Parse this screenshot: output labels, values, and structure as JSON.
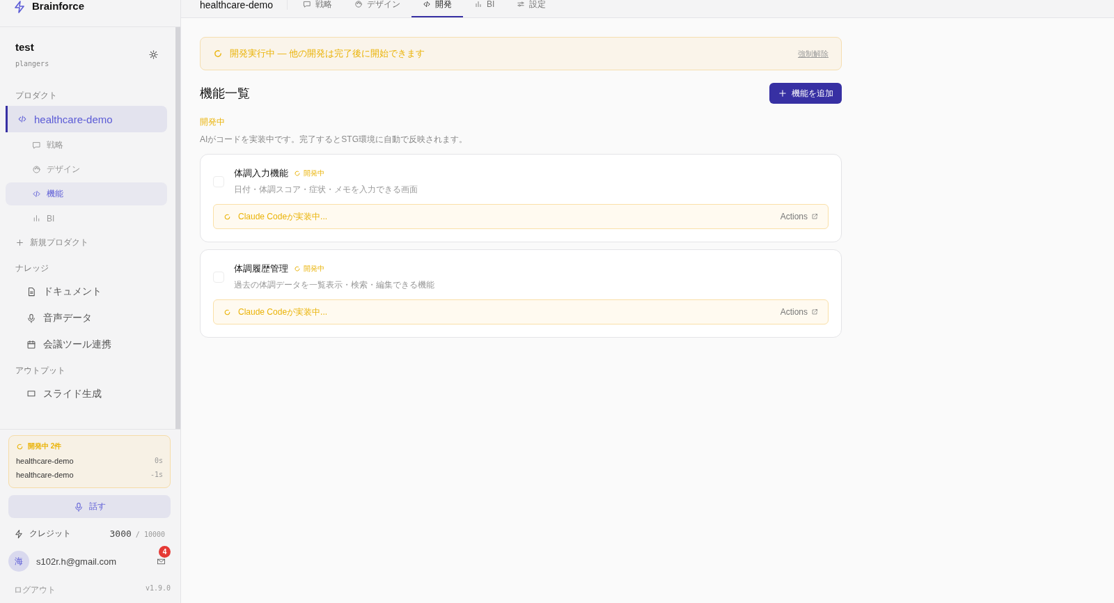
{
  "brand": {
    "name": "Brainforce"
  },
  "workspace": {
    "name": "test",
    "org": "plangers"
  },
  "product_section": {
    "label": "プロダクト",
    "products": [
      {
        "name": "healthcare-demo",
        "selected": true,
        "children": [
          {
            "label": "戦略",
            "kind": "chat",
            "selected": false
          },
          {
            "label": "デザイン",
            "kind": "palette",
            "selected": false
          },
          {
            "label": "機能",
            "kind": "code",
            "selected": true
          },
          {
            "label": "BI",
            "kind": "chart",
            "selected": false
          }
        ]
      }
    ],
    "new_product": "新規プロダクト"
  },
  "knowledge_section": {
    "label": "ナレッジ",
    "items": [
      {
        "label": "ドキュメント",
        "kind": "doc"
      },
      {
        "label": "音声データ",
        "kind": "mic"
      },
      {
        "label": "会議ツール連携",
        "kind": "calendar"
      }
    ]
  },
  "output_section": {
    "label": "アウトプット",
    "items": [
      {
        "label": "スライド生成",
        "kind": "slide"
      }
    ]
  },
  "running_panel": {
    "title": "開発中 2件",
    "items": [
      {
        "name": "healthcare-demo",
        "time": "0s"
      },
      {
        "name": "healthcare-demo",
        "time": "-1s"
      }
    ]
  },
  "talk_button": "話す",
  "credits": {
    "label": "クレジット",
    "value": "3000",
    "separator": "/",
    "total": "10000"
  },
  "user": {
    "avatar": "海",
    "email": "s102r.h@gmail.com",
    "unread": "4"
  },
  "footer": {
    "logout": "ログアウト",
    "version": "v1.9.0"
  },
  "header": {
    "project": "healthcare-demo",
    "tabs": [
      {
        "label": "戦略",
        "kind": "chat",
        "selected": false
      },
      {
        "label": "デザイン",
        "kind": "palette",
        "selected": false
      },
      {
        "label": "開発",
        "kind": "code",
        "selected": true
      },
      {
        "label": "BI",
        "kind": "chart",
        "selected": false
      },
      {
        "label": "設定",
        "kind": "sliders",
        "selected": false
      }
    ]
  },
  "banner": {
    "text": "開発実行中 — 他の開発は完了後に開始できます",
    "action": "強制解除"
  },
  "page_title": "機能一覧",
  "add_button": "機能を追加",
  "group": {
    "status": "開発中",
    "description": "AIがコードを実装中です。完了するとSTG環境に自動で反映されます。"
  },
  "features": [
    {
      "title": "体調入力機能",
      "status": "開発中",
      "description": "日付・体調スコア・症状・メモを入力できる画面",
      "checked": false,
      "progress": "Claude Codeが実装中...",
      "link": "Actions"
    },
    {
      "title": "体調履歴管理",
      "status": "開発中",
      "description": "過去の体調データを一覧表示・検索・編集できる機能",
      "checked": false,
      "progress": "Claude Codeが実装中...",
      "link": "Actions"
    }
  ]
}
